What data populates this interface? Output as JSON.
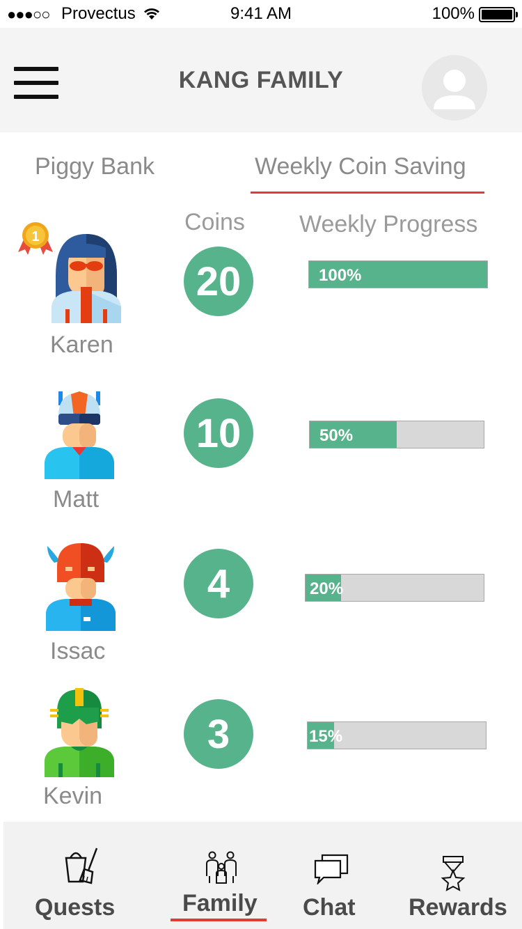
{
  "status_bar": {
    "signal": "●●●○○",
    "carrier": "Provectus",
    "time": "9:41 AM",
    "battery": "100%"
  },
  "header": {
    "title": "KANG FAMILY"
  },
  "tabs": [
    {
      "label": "Piggy Bank",
      "selected": false
    },
    {
      "label": "Weekly Coin Saving",
      "selected": true
    }
  ],
  "columns": {
    "coins": "Coins",
    "progress": "Weekly Progress"
  },
  "members": [
    {
      "name": "Karen",
      "coins": "20",
      "progress": 1.0,
      "progress_label": "100%",
      "medal": "1"
    },
    {
      "name": "Matt",
      "coins": "10",
      "progress": 0.5,
      "progress_label": "50%"
    },
    {
      "name": "Issac",
      "coins": "4",
      "progress": 0.2,
      "progress_label": "20%"
    },
    {
      "name": "Kevin",
      "coins": "3",
      "progress": 0.15,
      "progress_label": "15%"
    }
  ],
  "tabbar": [
    {
      "label": "Quests",
      "icon": "bucket-broom-icon"
    },
    {
      "label": "Family",
      "icon": "family-icon",
      "selected": true
    },
    {
      "label": "Chat",
      "icon": "chat-bubbles-icon"
    },
    {
      "label": "Rewards",
      "icon": "trophy-medal-icon"
    }
  ],
  "colors": {
    "accent_green": "#57b38c",
    "selected_underline": "#e53935",
    "header_bg": "#f4f4f4"
  }
}
